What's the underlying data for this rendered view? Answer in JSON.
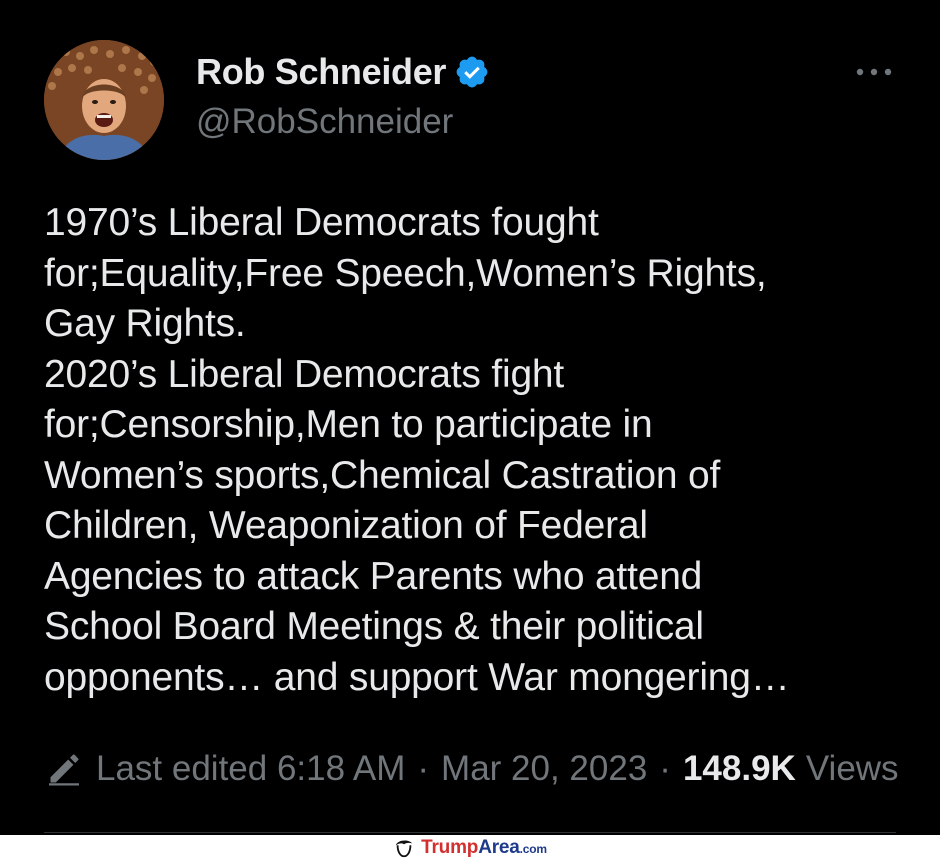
{
  "tweet": {
    "author": {
      "display_name": "Rob Schneider",
      "handle": "@RobSchneider",
      "verified": true
    },
    "text": "1970’s Liberal Democrats fought\nfor;Equality,Free Speech,Women’s Rights,\nGay Rights.\n2020’s Liberal Democrats fight\nfor;Censorship,Men to participate in\nWomen’s sports,Chemical Castration of\nChildren, Weaponization of Federal\nAgencies to attack Parents who attend\nSchool Board Meetings & their political\nopponents… and support War mongering…",
    "meta": {
      "edited_label": "Last edited 6:18 AM",
      "separator": "·",
      "date": "Mar 20, 2023",
      "views_count": "148.9K",
      "views_label": "Views"
    }
  },
  "watermark": {
    "brand_trump": "Trump",
    "brand_area": "Area",
    "brand_tld": ".com"
  },
  "colors": {
    "background": "#000000",
    "text_primary": "#e7e9ea",
    "text_secondary": "#71767b",
    "verified_blue": "#1d9bf0",
    "divider": "#2f3336"
  },
  "icons": {
    "verified": "verified-badge-icon",
    "more": "more-options-icon",
    "edit": "pencil-edit-icon",
    "watermark": "trump-hair-logo-icon"
  }
}
